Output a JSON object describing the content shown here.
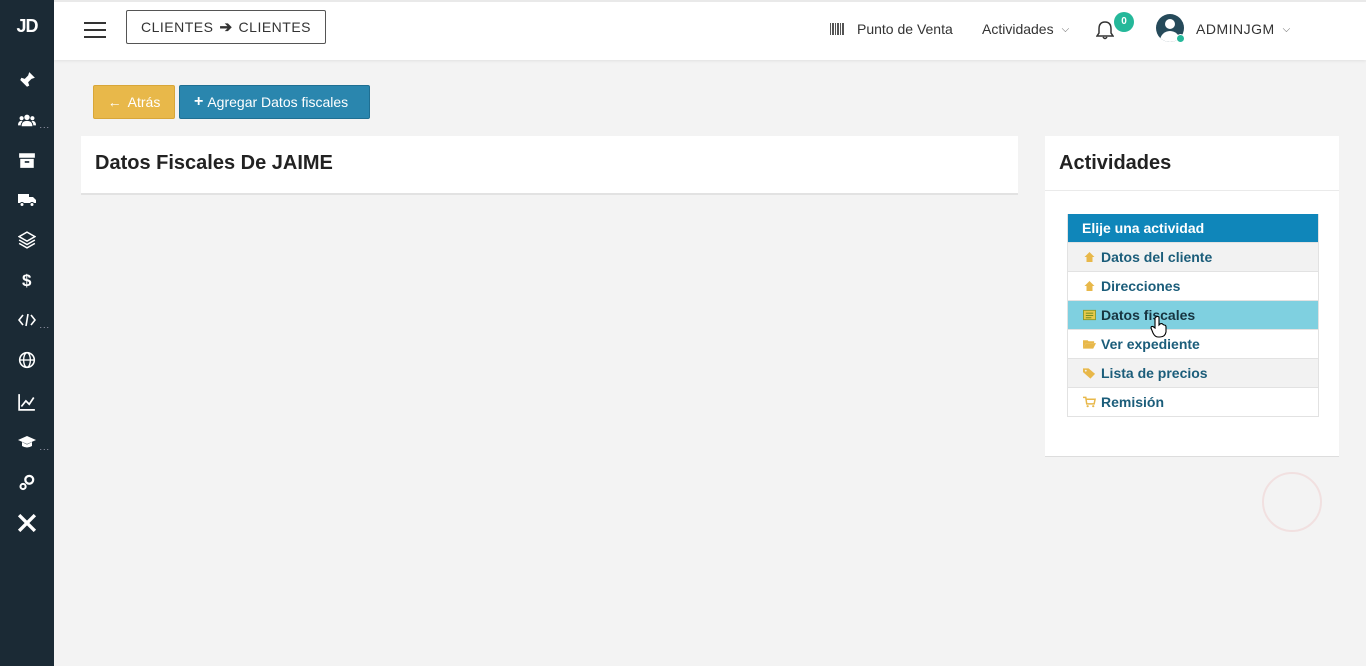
{
  "sidebar": {
    "logo": "JD",
    "icons": [
      "pin-icon",
      "users-icon",
      "archive-icon",
      "truck-icon",
      "layers-icon",
      "dollar-icon",
      "code-icon",
      "globe-icon",
      "chart-icon",
      "graduation-icon",
      "gears-icon",
      "plane-icon"
    ]
  },
  "header": {
    "breadcrumb_from": "CLIENTES",
    "breadcrumb_to": "CLIENTES",
    "pos_label": "Punto de Venta",
    "activities_label": "Actividades",
    "notifications_count": "0",
    "user_name": "ADMINJGM"
  },
  "actions": {
    "back_label": "Atrás",
    "add_label": "Agregar Datos fiscales"
  },
  "main": {
    "title": "Datos Fiscales De JAIME"
  },
  "activities": {
    "title": "Actividades",
    "list_header": "Elije una actividad",
    "items": [
      {
        "label": "Datos del cliente",
        "icon": "home-icon"
      },
      {
        "label": "Direcciones",
        "icon": "home-icon"
      },
      {
        "label": "Datos fiscales",
        "icon": "id-card-icon"
      },
      {
        "label": "Ver expediente",
        "icon": "folder-open-icon"
      },
      {
        "label": "Lista de precios",
        "icon": "tags-icon"
      },
      {
        "label": "Remisión",
        "icon": "cart-icon"
      }
    ],
    "active_index": 2
  },
  "colors": {
    "sidebar": "#1b2a35",
    "back_button": "#e8b84a",
    "add_button": "#2a86ae",
    "list_header": "#0f86ba",
    "active_item": "#7fd0e0",
    "icon_accent": "#e8b84a",
    "badge": "#25b89a"
  }
}
